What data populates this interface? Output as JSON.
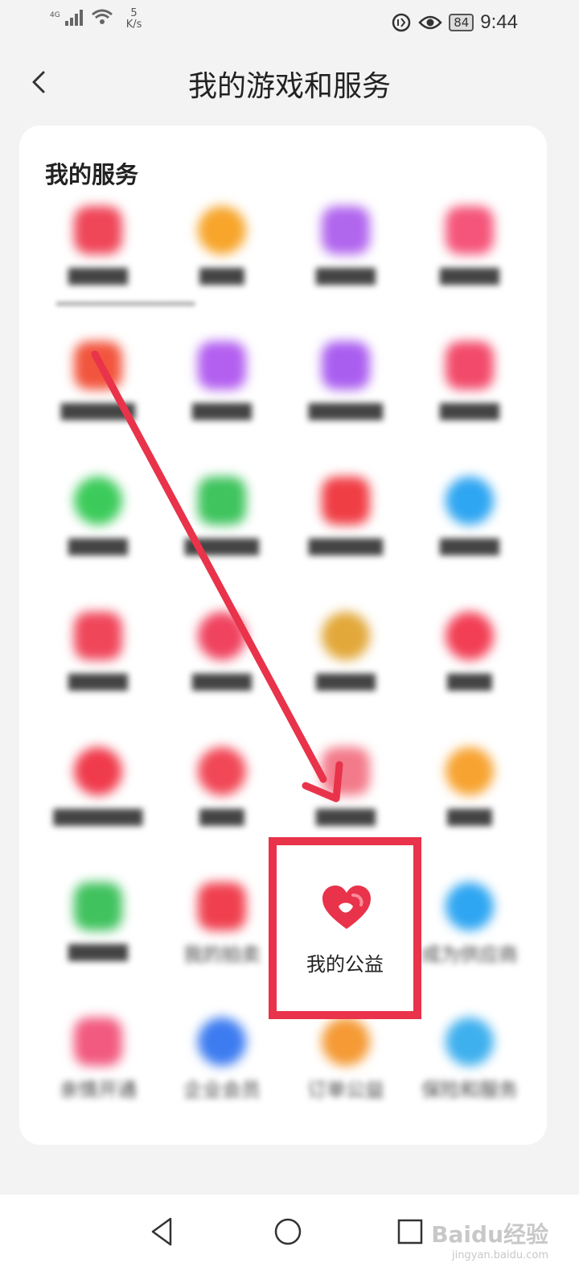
{
  "status_bar": {
    "network": "4G",
    "speed_value": "5",
    "speed_unit": "K/s",
    "battery": "84",
    "time": "9:44"
  },
  "header": {
    "title": "我的游戏和服务"
  },
  "services": {
    "section_title": "我的服务",
    "highlighted_item": {
      "label": "我的公益",
      "icon": "heart-icon",
      "color": "#e8334a"
    },
    "visible_labels": [
      "我的拍卖",
      "成为供应商",
      "亲情开通",
      "企业会员",
      "订单公益",
      "保险和服务"
    ]
  },
  "colors": {
    "accent_red": "#e8334a"
  },
  "watermark": {
    "text": "Baidu经验",
    "subtext": "jingyan.baidu.com"
  }
}
